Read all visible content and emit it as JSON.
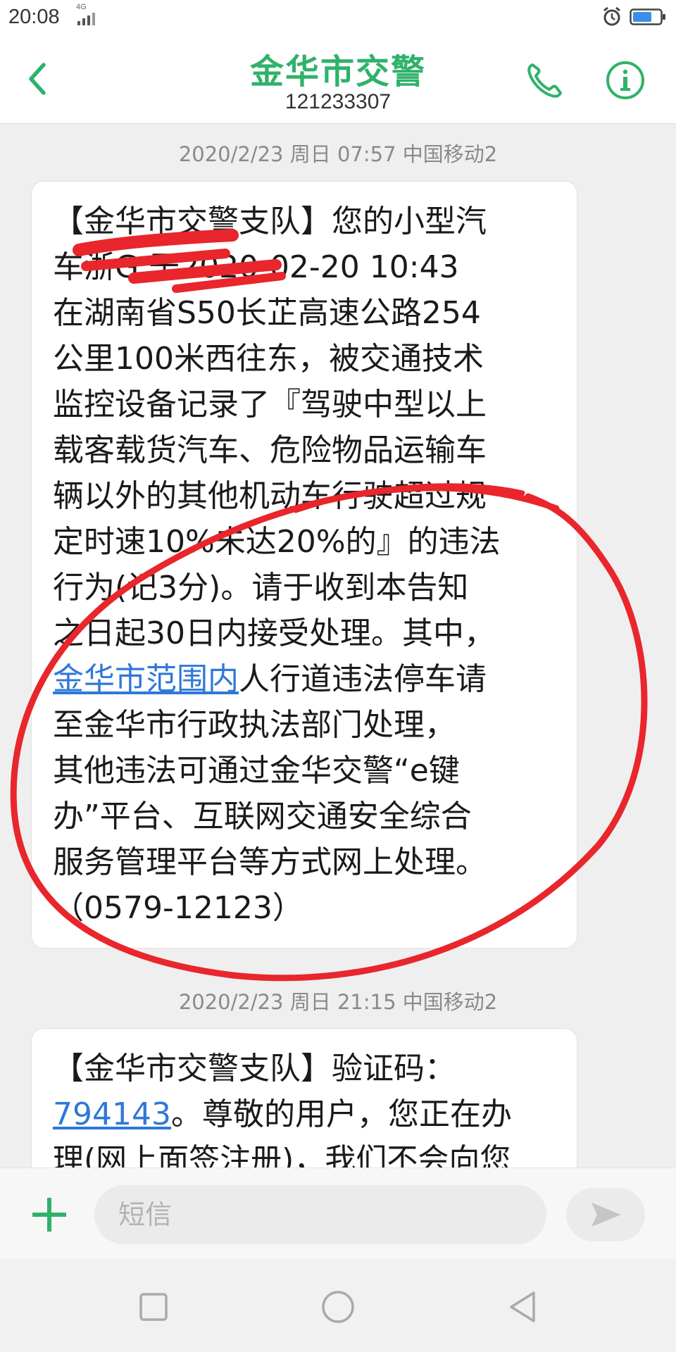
{
  "status_bar": {
    "time": "20:08",
    "network": "4G"
  },
  "header": {
    "contact_name": "金华市交警",
    "contact_number": "121233307"
  },
  "messages": [
    {
      "timestamp": "2020/2/23 周日 07:57  中国移动2",
      "lines": [
        "【金华市交警支队】您的小型汽",
        "车浙G      于2020-02-20 10:43",
        "在湖南省S50长芷高速公路254",
        "公里100米西往东，被交通技术",
        "监控设备记录了『驾驶中型以上",
        "载客载货汽车、危险物品运输车",
        "辆以外的其他机动车行驶超过规",
        "定时速10%未达20%的』的违法",
        "行为(记3分)。请于收到本告知",
        "之日起30日内接受处理。其中，"
      ],
      "link_text": "金华市范围内",
      "link_rest": "人行道违法停车请",
      "lines_after": [
        "至金华市行政执法部门处理，",
        "其他违法可通过金华交警“e键",
        "办”平台、互联网交通安全综合",
        "服务管理平台等方式网上处理。",
        "（0579-12123）"
      ]
    },
    {
      "timestamp": "2020/2/23 周日 21:15  中国移动2",
      "line1": "【金华市交警支队】验证码：",
      "code": "794143",
      "code_rest": "。尊敬的用户，您正在办",
      "line3": "理(网上面签注册)，我们不会向您"
    }
  ],
  "input": {
    "placeholder": "短信"
  },
  "colors": {
    "accent": "#2fb26a",
    "link": "#2f78d8",
    "markup": "#e8262c"
  }
}
